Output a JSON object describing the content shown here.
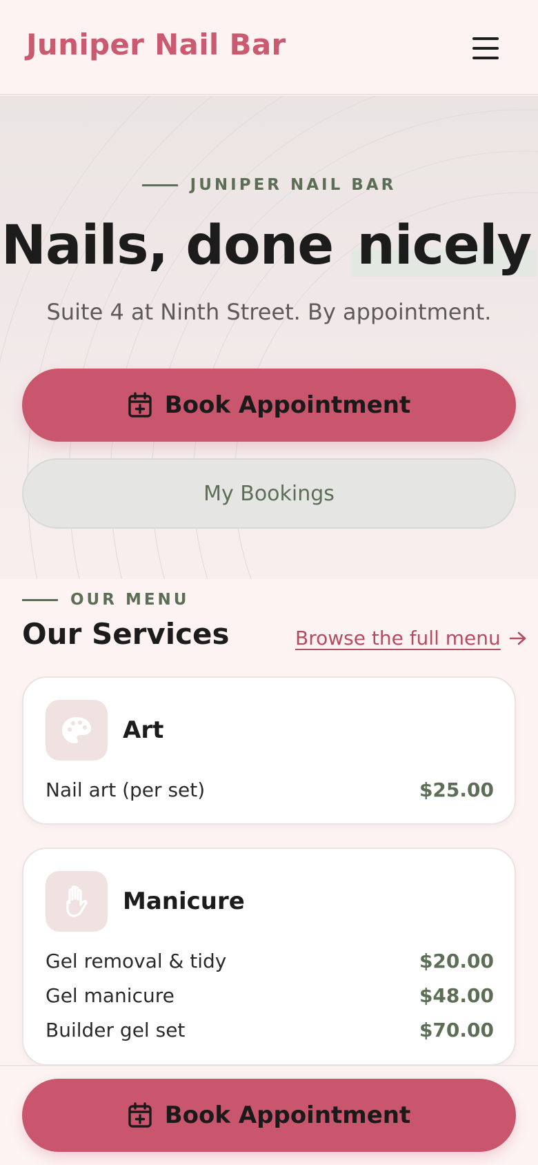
{
  "header": {
    "brand": "Juniper Nail Bar",
    "menu_icon": "hamburger-menu-icon"
  },
  "hero": {
    "eyebrow": "JUNIPER NAIL BAR",
    "title_main": "Nails, done",
    "title_highlight": "nicely",
    "subtitle": "Suite 4 at Ninth Street. By appointment.",
    "primary_button": "Book Appointment",
    "primary_icon": "calendar-plus-icon",
    "secondary_button": "My Bookings"
  },
  "services": {
    "eyebrow": "OUR MENU",
    "title": "Our Services",
    "browse_link": "Browse the full menu",
    "browse_icon": "arrow-right-icon",
    "categories": [
      {
        "name": "Art",
        "icon": "palette-icon",
        "items": [
          {
            "name": "Nail art (per set)",
            "price": "$25.00"
          }
        ]
      },
      {
        "name": "Manicure",
        "icon": "hand-icon",
        "items": [
          {
            "name": "Gel removal & tidy",
            "price": "$20.00"
          },
          {
            "name": "Gel manicure",
            "price": "$48.00"
          },
          {
            "name": "Builder gel set",
            "price": "$70.00"
          }
        ]
      }
    ]
  },
  "bottom_bar": {
    "button": "Book Appointment",
    "icon": "calendar-plus-icon"
  },
  "colors": {
    "brand": "#c95a6f",
    "primary_button": "#c9566c",
    "accent_green": "#5d6e57",
    "background": "#fdf3f3"
  }
}
